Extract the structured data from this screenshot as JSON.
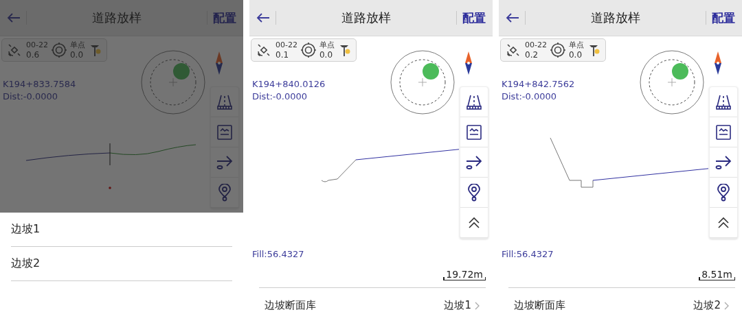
{
  "screens": [
    {
      "dimmed": true,
      "title": "道路放样",
      "config": "配置",
      "status": {
        "sats": "00-22",
        "sats_value": "0.6",
        "mode": "单点",
        "mode_value": "0.0"
      },
      "station": "K194+833.7584",
      "dist": "Dist:-0.0000",
      "tools": [
        {
          "kind": "road"
        },
        {
          "kind": "profile"
        },
        {
          "kind": "stake"
        },
        {
          "kind": "pin"
        }
      ],
      "options": [
        "边坡1",
        "边坡2"
      ]
    },
    {
      "dimmed": false,
      "title": "道路放样",
      "config": "配置",
      "status": {
        "sats": "00-22",
        "sats_value": "0.1",
        "mode": "单点",
        "mode_value": "0.0"
      },
      "station": "K194+840.0126",
      "dist": "Dist:-0.0000",
      "tools": [
        {
          "kind": "road"
        },
        {
          "kind": "profile"
        },
        {
          "kind": "stake"
        },
        {
          "kind": "pin"
        },
        {
          "kind": "collapse"
        }
      ],
      "fill": "Fill:56.4327",
      "scale": "19.72m",
      "library": {
        "label": "边坡断面库",
        "value": "边坡1"
      }
    },
    {
      "dimmed": false,
      "title": "道路放样",
      "config": "配置",
      "status": {
        "sats": "00-22",
        "sats_value": "0.2",
        "mode": "单点",
        "mode_value": "0.0"
      },
      "station": "K194+842.7562",
      "dist": "Dist:-0.0000",
      "tools": [
        {
          "kind": "road"
        },
        {
          "kind": "profile"
        },
        {
          "kind": "stake"
        },
        {
          "kind": "pin"
        },
        {
          "kind": "collapse"
        }
      ],
      "fill": "Fill:56.4327",
      "scale": "8.51m",
      "library": {
        "label": "边坡断面库",
        "value": "边坡2"
      }
    }
  ]
}
